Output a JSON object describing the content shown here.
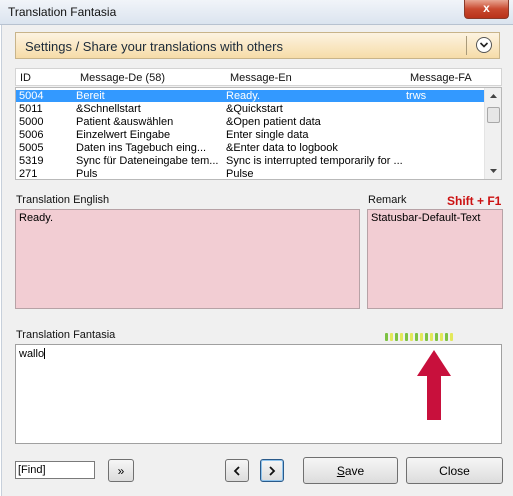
{
  "window": {
    "title": "Translation Fantasia",
    "close_glyph": "x"
  },
  "settings": {
    "text": "Settings / Share your translations with others",
    "expand_icon": "chevron-down-icon"
  },
  "list": {
    "headers": {
      "id": "ID",
      "de": "Message-De (58)",
      "en": "Message-En",
      "fa": "Message-FA"
    },
    "rows": [
      {
        "id": "5004",
        "de": "Bereit",
        "en": "Ready.",
        "fa": "trws",
        "selected": true
      },
      {
        "id": "5011",
        "de": "&Schnellstart",
        "en": "&Quickstart",
        "fa": ""
      },
      {
        "id": "5000",
        "de": "Patient &auswählen",
        "en": "&Open patient data",
        "fa": ""
      },
      {
        "id": "5006",
        "de": "Einzelwert Eingabe",
        "en": "Enter single data",
        "fa": ""
      },
      {
        "id": "5005",
        "de": "Daten ins Tagebuch eing...",
        "en": "&Enter data to logbook",
        "fa": ""
      },
      {
        "id": "5319",
        "de": "Sync für Dateneingabe tem...",
        "en": "Sync is interrupted temporarily for ...",
        "fa": ""
      },
      {
        "id": "271",
        "de": "Puls",
        "en": "Pulse",
        "fa": ""
      }
    ]
  },
  "english": {
    "label": "Translation English",
    "value": "Ready."
  },
  "remark": {
    "label": "Remark",
    "shortcut": "Shift + F1",
    "value": "Statusbar-Default-Text"
  },
  "fantasia": {
    "label": "Translation Fantasia",
    "value": "wallo"
  },
  "meter": {
    "segments": 14,
    "colors": {
      "green": "#7cc242",
      "yellow": "#e3e85a"
    }
  },
  "find": {
    "value": "[Find]",
    "next_label": "»"
  },
  "nav": {
    "prev_icon": "chevron-left-icon",
    "next_icon": "chevron-right-icon"
  },
  "buttons": {
    "save": "Save",
    "close": "Close"
  },
  "colors": {
    "accent_arrow": "#c8103c",
    "pink_field": "#f2cdd3",
    "selection": "#3399ff"
  }
}
